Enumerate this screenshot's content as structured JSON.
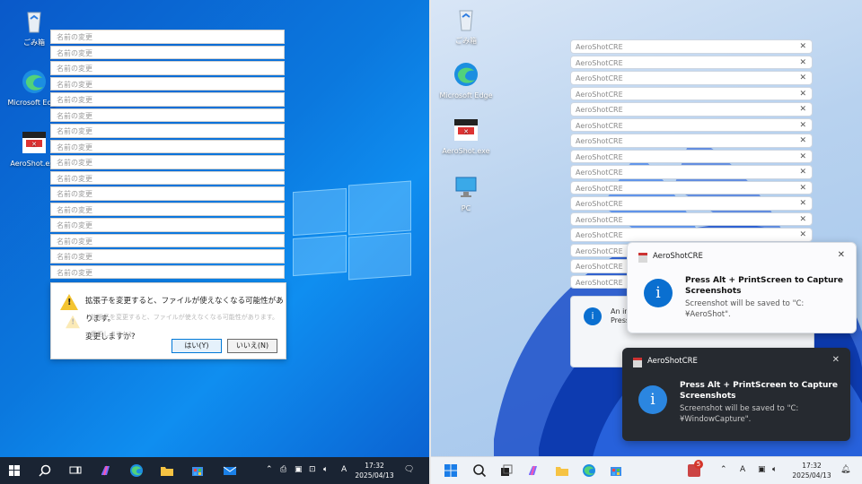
{
  "left_desktop": {
    "icons": [
      {
        "label": "ごみ箱"
      },
      {
        "label": "Microsoft Edge"
      },
      {
        "label": "AeroShot.exe"
      }
    ],
    "rename_windows": {
      "title": "名前の変更",
      "count": 16
    },
    "dialog": {
      "message_line1": "拡張子を変更すると、ファイルが使えなくなる可能性があります。",
      "message_line2": "変更しますか?",
      "ghost_line1": "拡張子を変更すると、ファイルが使えなくなる可能性があります。",
      "ghost_line2": "変更しますか?",
      "yes_label": "はい(Y)",
      "no_label": "いいえ(N)"
    },
    "taskbar": {
      "time": "17:32",
      "date": "2025/04/13",
      "ime": "A"
    }
  },
  "right_desktop": {
    "icons": [
      {
        "label": "ごみ箱"
      },
      {
        "label": "Microsoft Edge"
      },
      {
        "label": "AeroShot.exe"
      },
      {
        "label": "PC"
      }
    ],
    "windows": {
      "title": "AeroShotCRE",
      "count": 16
    },
    "partial_text": {
      "line1": "An ins",
      "line2": "Press"
    },
    "toast_light": {
      "app": "AeroShotCRE",
      "title": "Press Alt + PrintScreen to Capture Screenshots",
      "body": "Screenshot will be saved to \"C:¥AeroShot\"."
    },
    "toast_dark": {
      "app": "AeroShotCRE",
      "title": "Press Alt + PrintScreen to Capture Screenshots",
      "body": "Screenshot will be saved to \"C:¥WindowCapture\"."
    },
    "taskbar": {
      "badge": "5",
      "time": "17:32",
      "date": "2025/04/13",
      "ime": "A"
    }
  },
  "colors": {
    "win10_accent": "#0b78de",
    "win11_accent": "#0a6fd0",
    "warning": "#f4c430"
  }
}
